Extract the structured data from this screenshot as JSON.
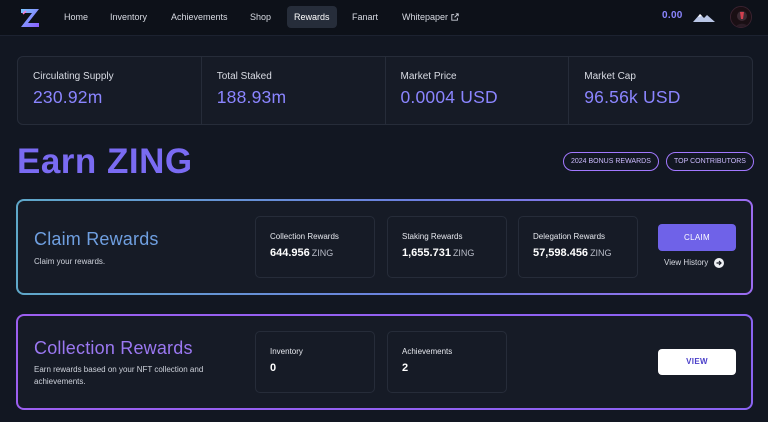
{
  "nav": {
    "items": [
      {
        "label": "Home"
      },
      {
        "label": "Inventory"
      },
      {
        "label": "Achievements"
      },
      {
        "label": "Shop"
      },
      {
        "label": "Rewards",
        "active": true
      },
      {
        "label": "Fanart"
      },
      {
        "label": "Whitepaper",
        "icon": "external-link-icon"
      }
    ],
    "balance": "0.00",
    "colors": {
      "accent": "#8b85ff",
      "active_bg": "#262d3a"
    }
  },
  "stats": [
    {
      "label": "Circulating Supply",
      "value": "230.92m"
    },
    {
      "label": "Total Staked",
      "value": "188.93m"
    },
    {
      "label": "Market Price",
      "value": "0.0004 USD"
    },
    {
      "label": "Market Cap",
      "value": "96.56k USD"
    }
  ],
  "earn": {
    "title": "Earn ZING",
    "pills": [
      "2024 BONUS REWARDS",
      "TOP CONTRIBUTORS"
    ]
  },
  "claim": {
    "title": "Claim Rewards",
    "description": "Claim your rewards.",
    "boxes": [
      {
        "label": "Collection Rewards",
        "value": "644.956",
        "unit": "ZING"
      },
      {
        "label": "Staking Rewards",
        "value": "1,655.731",
        "unit": "ZING"
      },
      {
        "label": "Delegation Rewards",
        "value": "57,598.456",
        "unit": "ZING"
      }
    ],
    "button": "CLAIM",
    "history": "View History"
  },
  "collection": {
    "title": "Collection Rewards",
    "description": "Earn rewards based on your NFT collection and achievements.",
    "boxes": [
      {
        "label": "Inventory",
        "value": "0"
      },
      {
        "label": "Achievements",
        "value": "2"
      }
    ],
    "button": "VIEW"
  }
}
